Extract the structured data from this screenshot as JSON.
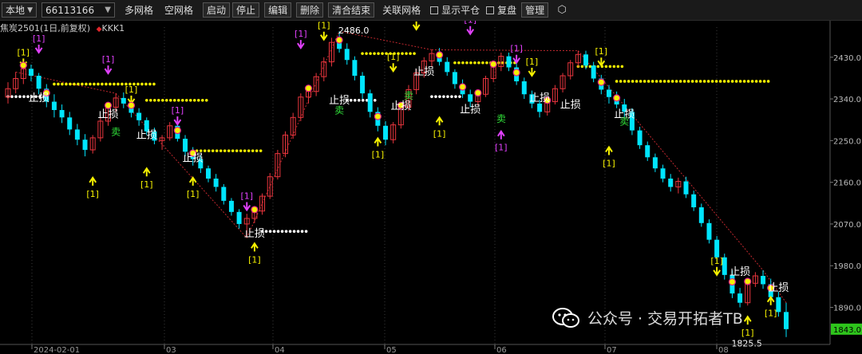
{
  "toolbar": {
    "market_select": "本地",
    "account_input": "66113166",
    "buttons": [
      "多网格",
      "空网格",
      "启动",
      "停止",
      "编辑",
      "删除",
      "清合结束",
      "关联网格"
    ],
    "boxed_buttons": [
      "启动",
      "停止",
      "编辑",
      "删除",
      "清合结束"
    ],
    "check_show_ping": "显示平仓",
    "check_fupan": "复盘",
    "manage": "管理",
    "settings_icon": "hexagon-gear-icon"
  },
  "chart_title": {
    "symbol": "焦炭2501(1日,前复权)",
    "indicator": "KKK1"
  },
  "colors": {
    "up": "#e8353d",
    "down": "#00e5ff",
    "dots_yellow": "#f5f000",
    "dots_white": "#ffffff",
    "label_magenta": "#e040fb",
    "label_yellow": "#f5f000",
    "label_green": "#31e23a",
    "last_price_bg": "#2ec51c"
  },
  "axis": {
    "y_ticks": [
      "2430.0",
      "2340.0",
      "2250.0",
      "2160.0",
      "2070.0",
      "1980.0",
      "1890.0"
    ],
    "x_ticks": [
      "2024-02-01",
      "03",
      "04",
      "05",
      "06",
      "07",
      "08"
    ],
    "last_price": "1843.0"
  },
  "annotations": {
    "high": "2486.0",
    "low": "1825.5",
    "signal_tag": "[1]",
    "stop_tag": "止损",
    "sell_tag": "卖"
  },
  "watermark": "公众号 · 交易开拓者TB",
  "chart_data": {
    "type": "candlestick",
    "y_range": [
      1810,
      2495
    ],
    "ohlc": [
      [
        2344,
        2376,
        2330,
        2362
      ],
      [
        2362,
        2398,
        2352,
        2384
      ],
      [
        2384,
        2420,
        2372,
        2405
      ],
      [
        2405,
        2414,
        2378,
        2390
      ],
      [
        2390,
        2396,
        2350,
        2362
      ],
      [
        2362,
        2372,
        2322,
        2334
      ],
      [
        2334,
        2350,
        2300,
        2316
      ],
      [
        2316,
        2328,
        2288,
        2300
      ],
      [
        2300,
        2312,
        2262,
        2274
      ],
      [
        2274,
        2286,
        2240,
        2252
      ],
      [
        2252,
        2264,
        2216,
        2230
      ],
      [
        2230,
        2262,
        2222,
        2256
      ],
      [
        2256,
        2300,
        2248,
        2292
      ],
      [
        2292,
        2330,
        2282,
        2322
      ],
      [
        2322,
        2352,
        2312,
        2342
      ],
      [
        2342,
        2354,
        2320,
        2330
      ],
      [
        2330,
        2342,
        2300,
        2310
      ],
      [
        2310,
        2320,
        2282,
        2294
      ],
      [
        2294,
        2300,
        2262,
        2270
      ],
      [
        2270,
        2278,
        2242,
        2250
      ],
      [
        2250,
        2262,
        2230,
        2256
      ],
      [
        2256,
        2290,
        2250,
        2282
      ],
      [
        2282,
        2290,
        2248,
        2254
      ],
      [
        2254,
        2262,
        2216,
        2226
      ],
      [
        2226,
        2236,
        2196,
        2210
      ],
      [
        2210,
        2218,
        2180,
        2190
      ],
      [
        2190,
        2196,
        2160,
        2168
      ],
      [
        2168,
        2178,
        2140,
        2150
      ],
      [
        2150,
        2156,
        2112,
        2120
      ],
      [
        2120,
        2126,
        2088,
        2096
      ],
      [
        2096,
        2102,
        2060,
        2070
      ],
      [
        2070,
        2092,
        2040,
        2082
      ],
      [
        2082,
        2104,
        2072,
        2098
      ],
      [
        2098,
        2136,
        2090,
        2130
      ],
      [
        2130,
        2180,
        2124,
        2172
      ],
      [
        2172,
        2230,
        2166,
        2222
      ],
      [
        2222,
        2270,
        2214,
        2262
      ],
      [
        2262,
        2310,
        2254,
        2300
      ],
      [
        2300,
        2352,
        2292,
        2344
      ],
      [
        2344,
        2370,
        2330,
        2356
      ],
      [
        2356,
        2396,
        2346,
        2388
      ],
      [
        2388,
        2430,
        2378,
        2420
      ],
      [
        2420,
        2472,
        2410,
        2462
      ],
      [
        2462,
        2486,
        2440,
        2448
      ],
      [
        2448,
        2460,
        2414,
        2424
      ],
      [
        2424,
        2432,
        2380,
        2390
      ],
      [
        2390,
        2398,
        2340,
        2352
      ],
      [
        2352,
        2360,
        2300,
        2312
      ],
      [
        2312,
        2322,
        2270,
        2282
      ],
      [
        2282,
        2292,
        2240,
        2252
      ],
      [
        2252,
        2290,
        2244,
        2284
      ],
      [
        2284,
        2330,
        2276,
        2322
      ],
      [
        2322,
        2370,
        2314,
        2360
      ],
      [
        2360,
        2404,
        2350,
        2396
      ],
      [
        2396,
        2430,
        2386,
        2422
      ],
      [
        2422,
        2446,
        2410,
        2438
      ],
      [
        2438,
        2450,
        2412,
        2420
      ],
      [
        2420,
        2430,
        2390,
        2398
      ],
      [
        2398,
        2404,
        2362,
        2372
      ],
      [
        2372,
        2382,
        2342,
        2350
      ],
      [
        2350,
        2360,
        2322,
        2334
      ],
      [
        2334,
        2356,
        2326,
        2350
      ],
      [
        2350,
        2390,
        2344,
        2384
      ],
      [
        2384,
        2420,
        2376,
        2410
      ],
      [
        2410,
        2440,
        2400,
        2432
      ],
      [
        2432,
        2440,
        2400,
        2408
      ],
      [
        2408,
        2416,
        2370,
        2378
      ],
      [
        2378,
        2386,
        2340,
        2350
      ],
      [
        2350,
        2358,
        2320,
        2330
      ],
      [
        2330,
        2338,
        2300,
        2312
      ],
      [
        2312,
        2340,
        2304,
        2334
      ],
      [
        2334,
        2370,
        2328,
        2362
      ],
      [
        2362,
        2396,
        2354,
        2390
      ],
      [
        2390,
        2424,
        2382,
        2418
      ],
      [
        2418,
        2444,
        2408,
        2436
      ],
      [
        2436,
        2444,
        2404,
        2412
      ],
      [
        2412,
        2420,
        2376,
        2384
      ],
      [
        2384,
        2392,
        2350,
        2360
      ],
      [
        2360,
        2370,
        2330,
        2344
      ],
      [
        2344,
        2356,
        2320,
        2328
      ],
      [
        2328,
        2340,
        2300,
        2312
      ],
      [
        2312,
        2320,
        2262,
        2272
      ],
      [
        2272,
        2280,
        2232,
        2240
      ],
      [
        2240,
        2248,
        2206,
        2214
      ],
      [
        2214,
        2222,
        2182,
        2190
      ],
      [
        2190,
        2198,
        2160,
        2168
      ],
      [
        2168,
        2178,
        2140,
        2150
      ],
      [
        2150,
        2170,
        2136,
        2162
      ],
      [
        2162,
        2172,
        2126,
        2134
      ],
      [
        2134,
        2142,
        2098,
        2106
      ],
      [
        2106,
        2114,
        2064,
        2072
      ],
      [
        2072,
        2080,
        2028,
        2036
      ],
      [
        2036,
        2044,
        1990,
        1998
      ],
      [
        1998,
        2006,
        1950,
        1960
      ],
      [
        1960,
        1970,
        1910,
        1920
      ],
      [
        1920,
        1932,
        1890,
        1900
      ],
      [
        1900,
        1950,
        1894,
        1942
      ],
      [
        1942,
        1966,
        1934,
        1958
      ],
      [
        1958,
        1970,
        1930,
        1940
      ],
      [
        1940,
        1952,
        1900,
        1912
      ],
      [
        1912,
        1924,
        1870,
        1880
      ],
      [
        1880,
        1900,
        1826,
        1843
      ]
    ]
  }
}
